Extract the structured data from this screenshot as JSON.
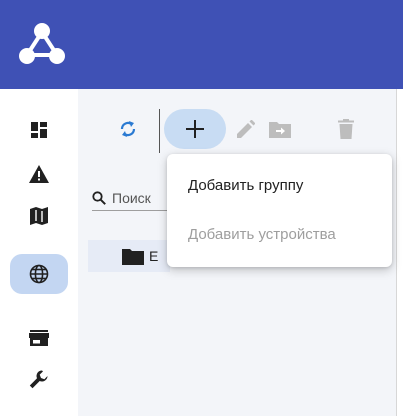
{
  "colors": {
    "topbar": "#3f51b5",
    "accent_light": "#c8dcf3",
    "sidebar_active": "#c3d6f2",
    "icon": "#212121",
    "icon_disabled": "#bdbdbd",
    "sync_accent": "#2a7ad2"
  },
  "header": {
    "logo_icon": "graph-logo-icon"
  },
  "sidebar": {
    "items": [
      {
        "icon": "dashboard-icon"
      },
      {
        "icon": "warning-icon"
      },
      {
        "icon": "map-icon"
      },
      {
        "icon": "globe-icon",
        "active": true
      },
      {
        "icon": "store-icon"
      },
      {
        "icon": "wrench-icon"
      }
    ]
  },
  "toolbar": {
    "buttons": [
      {
        "icon": "sync-icon",
        "enabled": true
      },
      {
        "icon": "plus-icon",
        "enabled": true,
        "active": true
      },
      {
        "icon": "pencil-icon",
        "enabled": false
      },
      {
        "icon": "folder-move-icon",
        "enabled": false
      },
      {
        "icon": "trash-icon",
        "enabled": false
      }
    ]
  },
  "search": {
    "placeholder": "Поиск"
  },
  "tree": {
    "items": [
      {
        "icon": "folder-icon",
        "label": "Е"
      }
    ]
  },
  "add_menu": {
    "items": [
      {
        "label": "Добавить группу",
        "enabled": true
      },
      {
        "label": "Добавить устройства",
        "enabled": false
      }
    ]
  }
}
